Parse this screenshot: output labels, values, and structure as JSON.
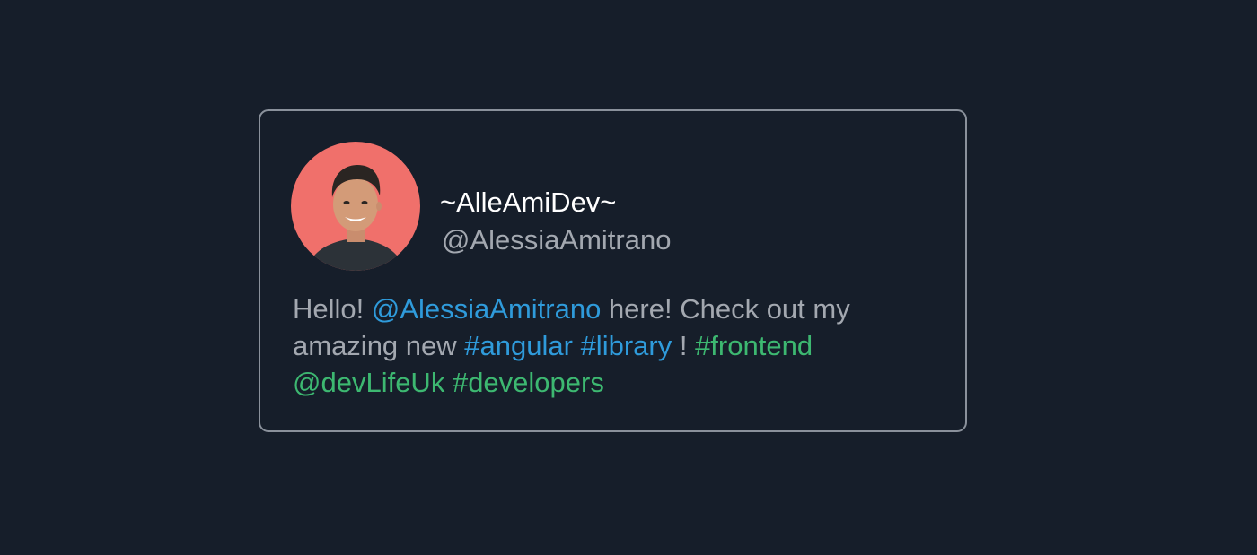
{
  "profile": {
    "display_name": "~AlleAmiDev~",
    "handle": "@AlessiaAmitrano",
    "avatar_color": "#f0706b"
  },
  "tweet": {
    "line1": {
      "text1": "Hello! ",
      "mention": "@AlessiaAmitrano",
      "text2": " here! Check out my"
    },
    "line2": {
      "text1": "amazing new ",
      "tag1": "#angular",
      "space": " ",
      "tag2": "#library",
      "text2": " ! ",
      "tag3": "#frontend"
    },
    "line3": {
      "mention": "@devLifeUk",
      "space": " ",
      "tag": "#developers"
    }
  },
  "colors": {
    "background": "#161e2a",
    "border": "#8a919b",
    "link_blue": "#2f9bdb",
    "link_green": "#3db871",
    "text_gray": "#a3a8b0"
  }
}
